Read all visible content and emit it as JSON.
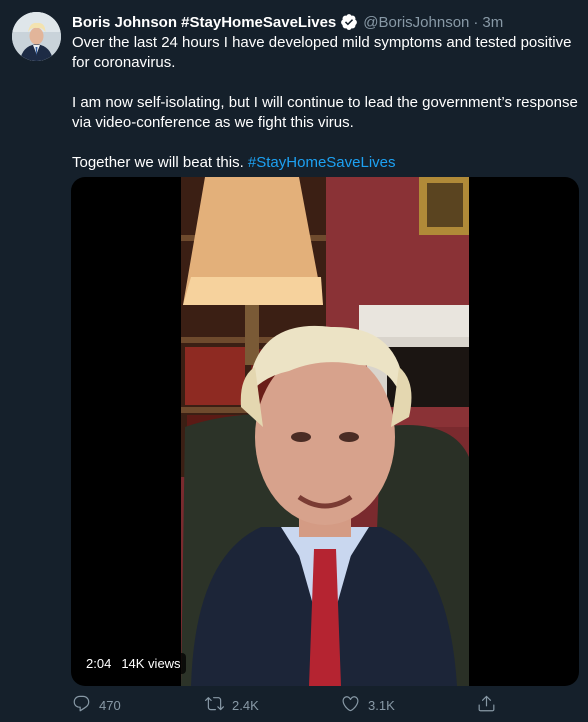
{
  "tweet": {
    "author": {
      "display_name": "Boris Johnson #StayHomeSaveLives",
      "handle": "@BorisJohnson",
      "separator": "·",
      "time": "3m",
      "verified_icon": "verified-badge-icon"
    },
    "paragraphs": [
      "Over the last 24 hours I have developed mild symptoms and tested positive for coronavirus.",
      "I am now self-isolating, but I will continue to lead the government’s response via video-conference as we fight this virus."
    ],
    "closing_text": "Together we will beat this. ",
    "closing_hashtag": "#StayHomeSaveLives",
    "video": {
      "duration": "2:04",
      "views": "14K views"
    },
    "actions": {
      "reply_count": "470",
      "retweet_count": "2.4K",
      "like_count": "3.1K"
    }
  },
  "colors": {
    "background": "#15202b",
    "secondary_text": "#8899a6",
    "link": "#1da1f2"
  }
}
